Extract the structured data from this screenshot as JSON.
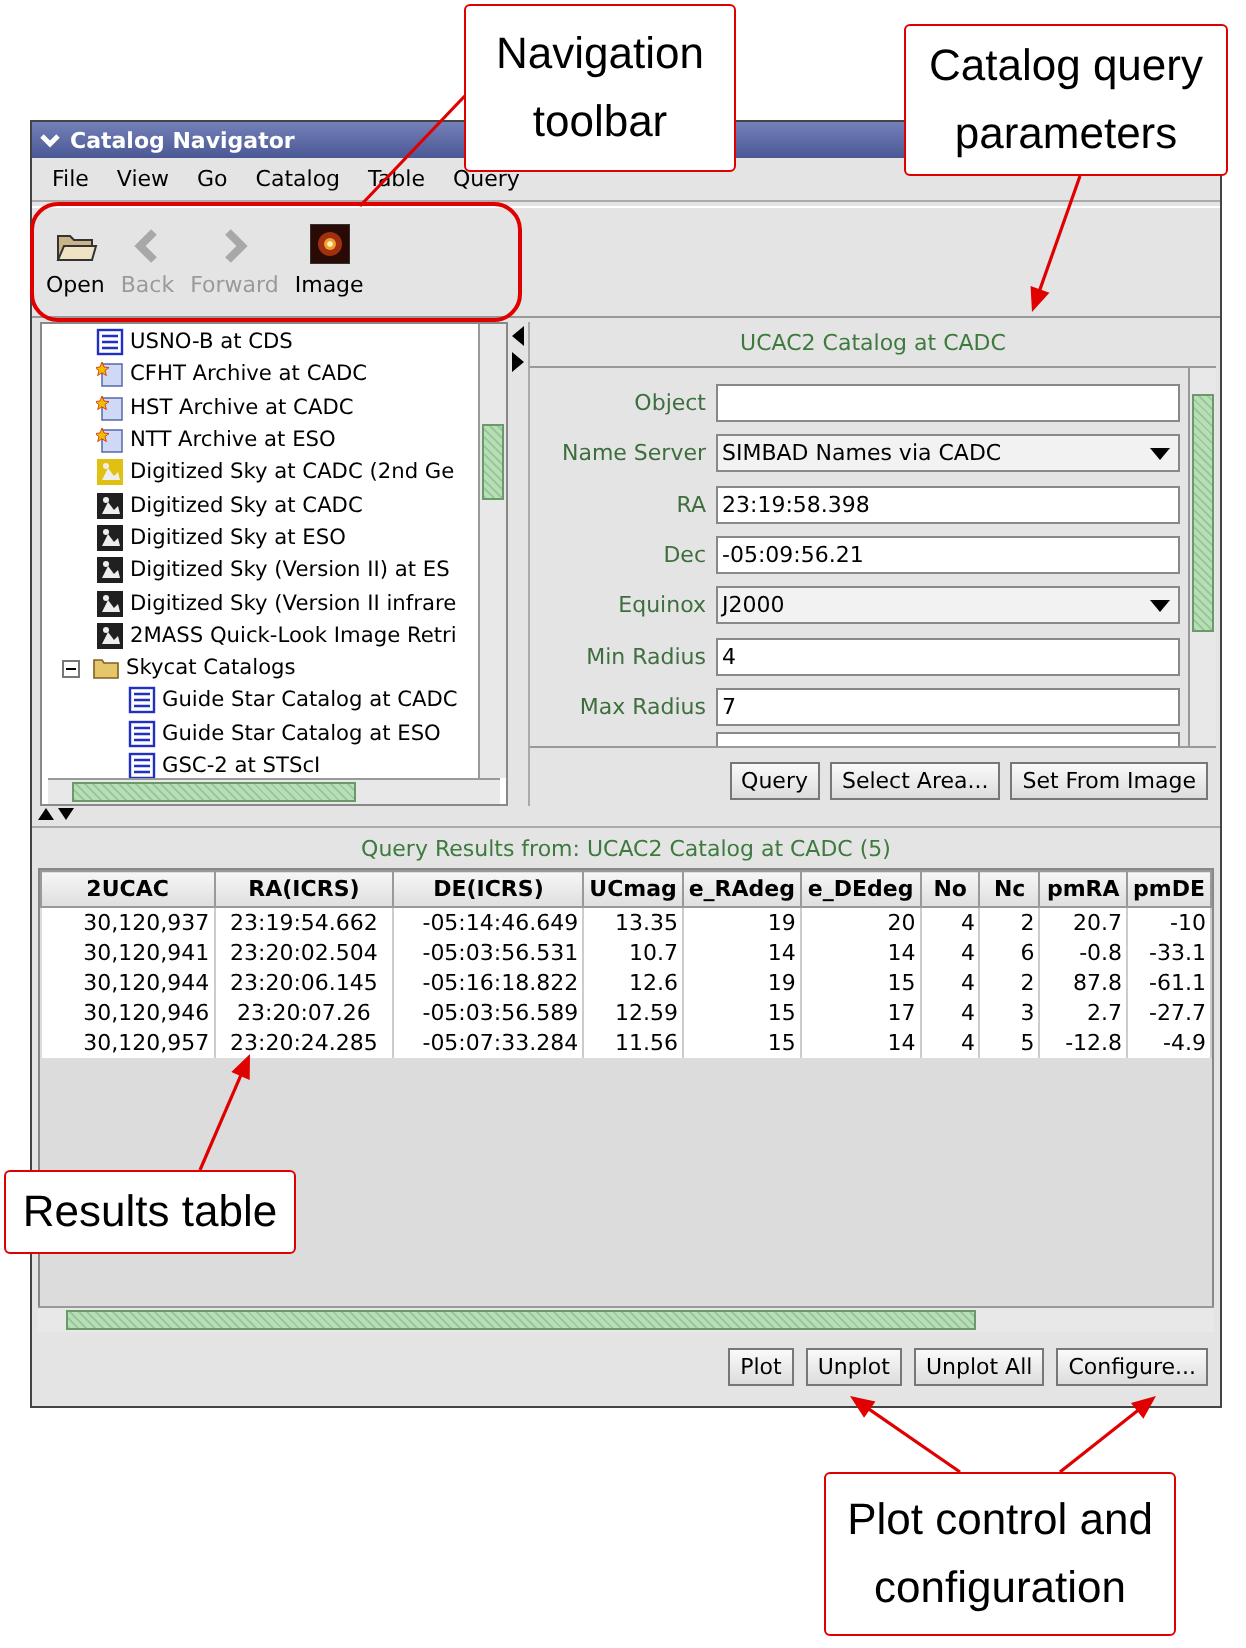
{
  "window": {
    "title": "Catalog Navigator"
  },
  "menu": [
    "File",
    "View",
    "Go",
    "Catalog",
    "Table",
    "Query"
  ],
  "toolbar": [
    {
      "label": "Open",
      "kind": "open",
      "disabled": false
    },
    {
      "label": "Back",
      "kind": "back",
      "disabled": true
    },
    {
      "label": "Forward",
      "kind": "forward",
      "disabled": true
    },
    {
      "label": "Image",
      "kind": "image",
      "disabled": false
    }
  ],
  "tree": {
    "items": [
      {
        "label": "USNO-B at CDS",
        "kind": "catalog"
      },
      {
        "label": "CFHT Archive at CADC",
        "kind": "archive"
      },
      {
        "label": "HST Archive at CADC",
        "kind": "archive"
      },
      {
        "label": "NTT Archive at ESO",
        "kind": "archive"
      },
      {
        "label": "Digitized Sky at CADC (2nd Ge",
        "kind": "image-server-highlight"
      },
      {
        "label": "Digitized Sky at CADC",
        "kind": "image-server"
      },
      {
        "label": "Digitized Sky at ESO",
        "kind": "image-server"
      },
      {
        "label": "Digitized Sky (Version II) at ES",
        "kind": "image-server"
      },
      {
        "label": "Digitized Sky (Version II infrare",
        "kind": "image-server"
      },
      {
        "label": "2MASS Quick-Look Image Retri",
        "kind": "image-server"
      },
      {
        "label": "Skycat Catalogs",
        "kind": "folder",
        "expanded": true,
        "children": [
          {
            "label": "Guide Star Catalog at CADC",
            "kind": "catalog"
          },
          {
            "label": "Guide Star Catalog at ESO",
            "kind": "catalog"
          },
          {
            "label": "GSC-2 at STScI",
            "kind": "catalog"
          }
        ]
      }
    ]
  },
  "query_panel": {
    "title": "UCAC2 Catalog at CADC",
    "fields": [
      {
        "label": "Object",
        "kind": "text"
      },
      {
        "label": "Name Server",
        "kind": "select",
        "value": "SIMBAD Names via CADC"
      },
      {
        "label": "RA",
        "kind": "text",
        "value": "23:19:58.398"
      },
      {
        "label": "Dec",
        "kind": "text",
        "value": "-05:09:56.21"
      },
      {
        "label": "Equinox",
        "kind": "select",
        "value": "J2000"
      },
      {
        "label": "Min Radius",
        "kind": "text",
        "value": "4"
      },
      {
        "label": "Max Radius",
        "kind": "text",
        "value": "7"
      },
      {
        "kind": "partial"
      }
    ],
    "buttons": [
      "Query",
      "Select Area...",
      "Set From Image"
    ]
  },
  "results": {
    "title": "Query Results from: UCAC2 Catalog at CADC (5)",
    "columns": [
      "2UCAC",
      "RA(ICRS)",
      "DE(ICRS)",
      "UCmag",
      "e_RAdeg",
      "e_DEdeg",
      "No",
      "Nc",
      "pmRA",
      "pmDE"
    ],
    "rows": [
      [
        "30,120,937",
        "23:19:54.662",
        "-05:14:46.649",
        "13.35",
        "19",
        "20",
        "4",
        "2",
        "20.7",
        "-10"
      ],
      [
        "30,120,941",
        "23:20:02.504",
        "-05:03:56.531",
        "10.7",
        "14",
        "14",
        "4",
        "6",
        "-0.8",
        "-33.1"
      ],
      [
        "30,120,944",
        "23:20:06.145",
        "-05:16:18.822",
        "12.6",
        "19",
        "15",
        "4",
        "2",
        "87.8",
        "-61.1"
      ],
      [
        "30,120,946",
        "23:20:07.26",
        "-05:03:56.589",
        "12.59",
        "15",
        "17",
        "4",
        "3",
        "2.7",
        "-27.7"
      ],
      [
        "30,120,957",
        "23:20:24.285",
        "-05:07:33.284",
        "11.56",
        "15",
        "14",
        "4",
        "5",
        "-12.8",
        "-4.9"
      ]
    ]
  },
  "plot_buttons": [
    "Plot",
    "Unplot",
    "Unplot All",
    "Configure..."
  ],
  "callouts": [
    "Navigation toolbar",
    "Catalog query parameters",
    "Results table",
    "Plot control and configuration"
  ]
}
